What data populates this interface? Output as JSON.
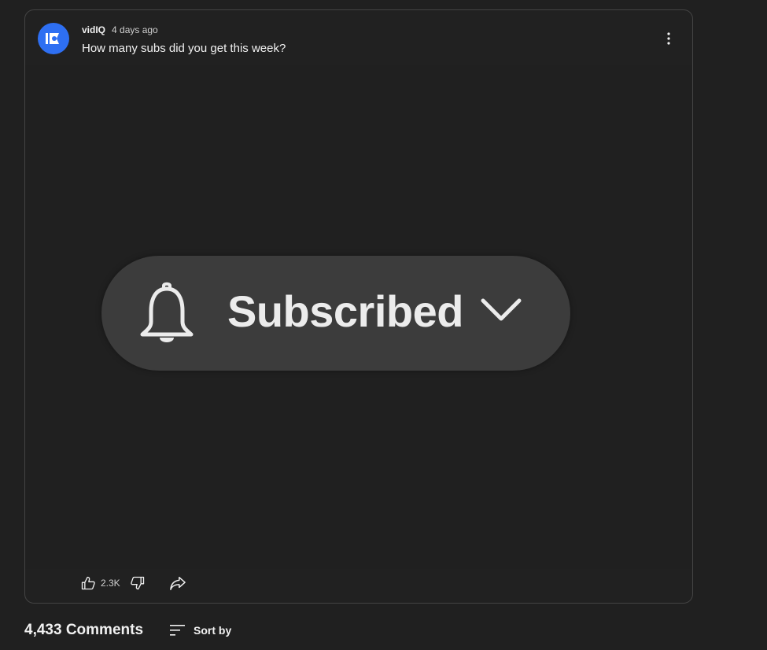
{
  "post": {
    "author": "vidIQ",
    "time": "4 days ago",
    "text": "How many subs did you get this week?",
    "avatar_color": "#2e6ff2",
    "image": {
      "button_label": "Subscribed",
      "icons": [
        "bell-icon",
        "chevron-down-icon"
      ]
    },
    "actions": {
      "like_count": "2.3K",
      "icons": [
        "thumbs-up-icon",
        "thumbs-down-icon",
        "share-icon",
        "more-vert-icon"
      ]
    }
  },
  "comments": {
    "count_label": "4,433 Comments",
    "sort_label": "Sort by"
  }
}
